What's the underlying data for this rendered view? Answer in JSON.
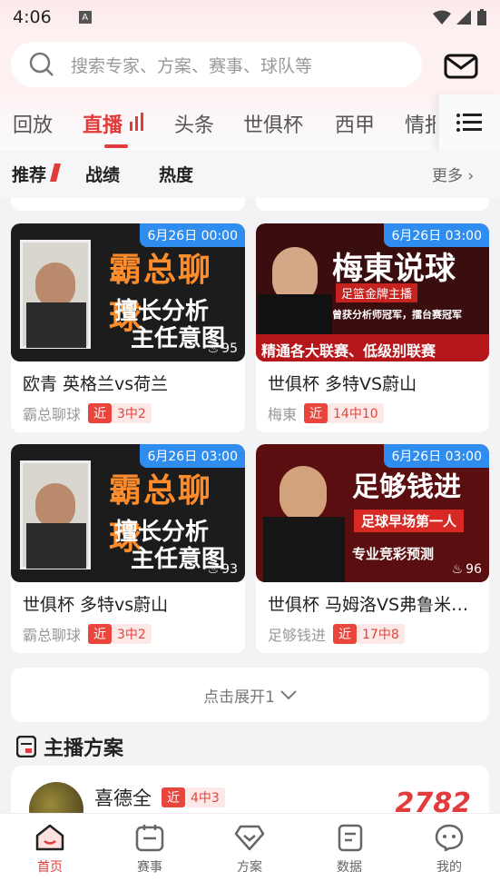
{
  "status": {
    "time": "4:06"
  },
  "search": {
    "placeholder": "搜索专家、方案、赛事、球队等"
  },
  "tabs": [
    "回放",
    "直播",
    "头条",
    "世俱杯",
    "西甲",
    "情报"
  ],
  "subtabs": [
    "推荐",
    "战绩",
    "热度"
  ],
  "more_label": "更多",
  "cards": [
    {
      "date": "6月26日 00:00",
      "heat": "95",
      "title": "欧青  英格兰vs荷兰",
      "author": "霸总聊球",
      "near": "近",
      "record": "3中2",
      "thumb_title": "霸总聊球",
      "thumb_line1": "擅长分析",
      "thumb_line2": "主任意图"
    },
    {
      "date": "6月26日 03:00",
      "heat": "",
      "title": "世俱杯  多特VS蔚山",
      "author": "梅東",
      "near": "近",
      "record": "14中10",
      "thumb_title": "梅東说球",
      "thumb_sub": "足篮金牌主播",
      "thumb_sub2": "曾获分析师冠军，擂台赛冠军",
      "thumb_bottom": "精通各大联赛、低级别联赛"
    },
    {
      "date": "6月26日 03:00",
      "heat": "93",
      "title": "世俱杯  多特vs蔚山",
      "author": "霸总聊球",
      "near": "近",
      "record": "3中2",
      "thumb_title": "霸总聊球",
      "thumb_line1": "擅长分析",
      "thumb_line2": "主任意图"
    },
    {
      "date": "6月26日 03:00",
      "heat": "96",
      "title": "世俱杯  马姆洛VS弗鲁米内塞",
      "author": "足够钱进",
      "near": "近",
      "record": "17中8",
      "thumb_title": "足够钱进",
      "thumb_sub": "足球早场第一人",
      "thumb_sub2": "专业竞彩预测"
    }
  ],
  "expand_label": "点击展开1",
  "section_title": "主播方案",
  "anchor": {
    "name": "喜德全",
    "near": "近",
    "record": "4中3",
    "number": "2782"
  },
  "nav": [
    "首页",
    "赛事",
    "方案",
    "数据",
    "我的"
  ]
}
